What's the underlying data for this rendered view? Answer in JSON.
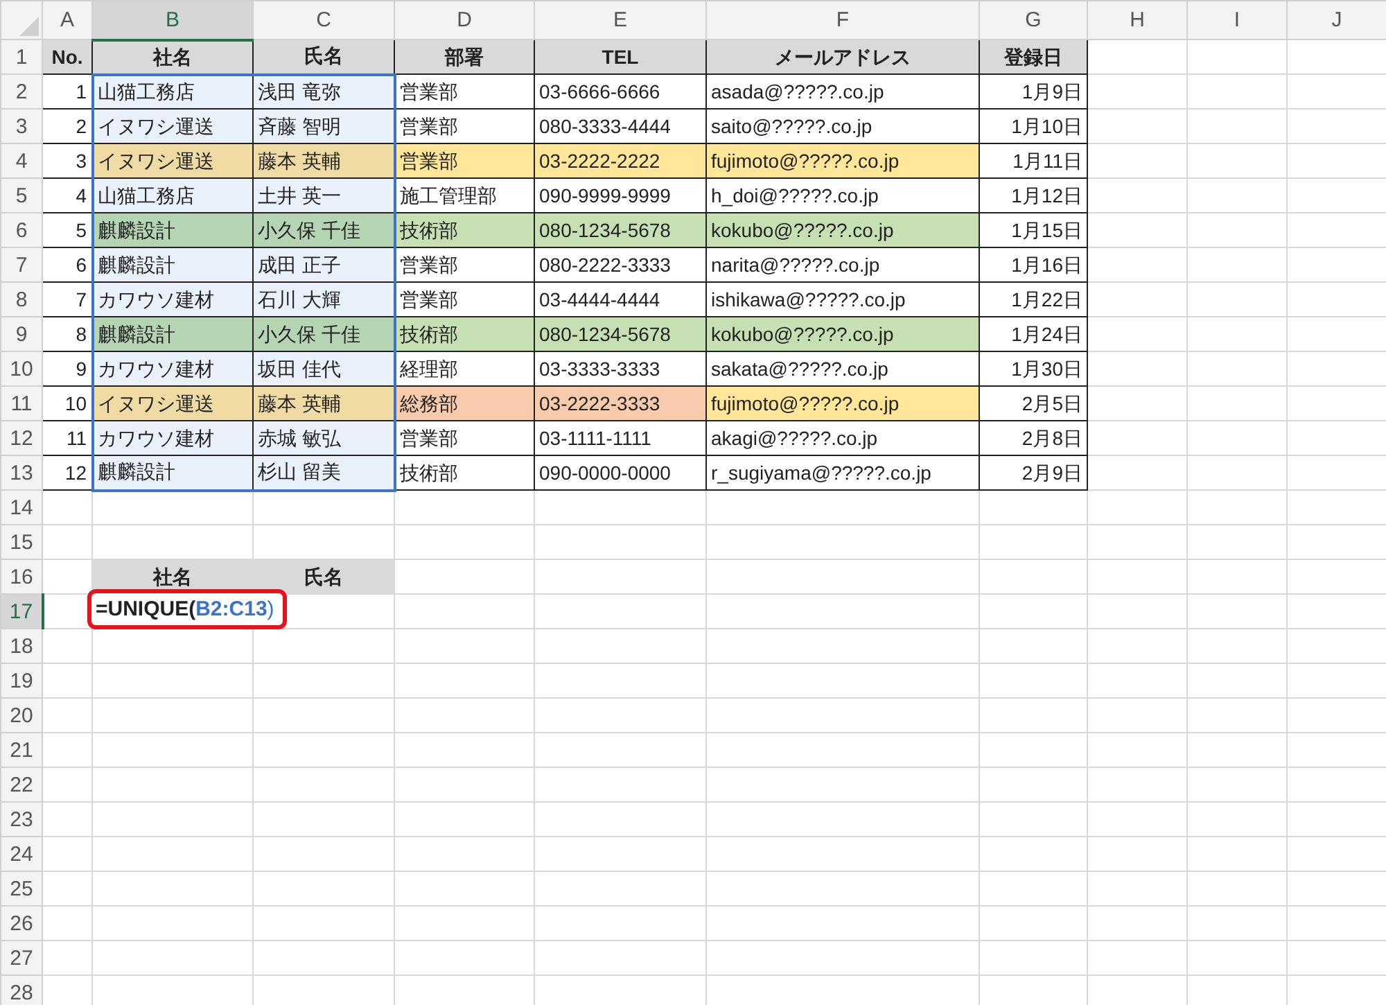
{
  "column_headers": [
    {
      "label": "A",
      "selected": false
    },
    {
      "label": "B",
      "selected": true
    },
    {
      "label": "C",
      "selected": false
    },
    {
      "label": "D",
      "selected": false
    },
    {
      "label": "E",
      "selected": false
    },
    {
      "label": "F",
      "selected": false
    },
    {
      "label": "G",
      "selected": false
    },
    {
      "label": "H",
      "selected": false
    },
    {
      "label": "I",
      "selected": false
    },
    {
      "label": "J",
      "selected": false
    }
  ],
  "row_headers": [
    {
      "label": "1",
      "selected": false
    },
    {
      "label": "2",
      "selected": false
    },
    {
      "label": "3",
      "selected": false
    },
    {
      "label": "4",
      "selected": false
    },
    {
      "label": "5",
      "selected": false
    },
    {
      "label": "6",
      "selected": false
    },
    {
      "label": "7",
      "selected": false
    },
    {
      "label": "8",
      "selected": false
    },
    {
      "label": "9",
      "selected": false
    },
    {
      "label": "10",
      "selected": false
    },
    {
      "label": "11",
      "selected": false
    },
    {
      "label": "12",
      "selected": false
    },
    {
      "label": "13",
      "selected": false
    },
    {
      "label": "14",
      "selected": false
    },
    {
      "label": "15",
      "selected": false
    },
    {
      "label": "16",
      "selected": false
    },
    {
      "label": "17",
      "selected": true
    },
    {
      "label": "18",
      "selected": false
    },
    {
      "label": "19",
      "selected": false
    },
    {
      "label": "20",
      "selected": false
    },
    {
      "label": "21",
      "selected": false
    },
    {
      "label": "22",
      "selected": false
    },
    {
      "label": "23",
      "selected": false
    },
    {
      "label": "24",
      "selected": false
    },
    {
      "label": "25",
      "selected": false
    },
    {
      "label": "26",
      "selected": false
    },
    {
      "label": "27",
      "selected": false
    },
    {
      "label": "28",
      "selected": false
    }
  ],
  "table": {
    "columns": [
      {
        "label": "No.",
        "kind": "number",
        "referenced": false
      },
      {
        "label": "社名",
        "kind": "text",
        "referenced": true
      },
      {
        "label": "氏名",
        "kind": "text",
        "referenced": true
      },
      {
        "label": "部署",
        "kind": "text",
        "referenced": false
      },
      {
        "label": "TEL",
        "kind": "text",
        "referenced": false
      },
      {
        "label": "メールアドレス",
        "kind": "text",
        "referenced": false
      },
      {
        "label": "登録日",
        "kind": "date",
        "referenced": false
      }
    ],
    "rows": [
      {
        "cells": [
          {
            "text": "1"
          },
          {
            "text": "山猫工務店"
          },
          {
            "text": "浅田 竜弥"
          },
          {
            "text": "営業部"
          },
          {
            "text": "03-6666-6666"
          },
          {
            "text": "asada@?????.co.jp"
          },
          {
            "text": "1月9日"
          }
        ]
      },
      {
        "cells": [
          {
            "text": "2"
          },
          {
            "text": "イヌワシ運送"
          },
          {
            "text": "斉藤 智明"
          },
          {
            "text": "営業部"
          },
          {
            "text": "080-3333-4444"
          },
          {
            "text": "saito@?????.co.jp"
          },
          {
            "text": "1月10日"
          }
        ]
      },
      {
        "cells": [
          {
            "text": "3"
          },
          {
            "text": "イヌワシ運送",
            "color": "#efdba3"
          },
          {
            "text": "藤本 英輔",
            "color": "#efdba3"
          },
          {
            "text": "営業部",
            "color": "#ffe699"
          },
          {
            "text": "03-2222-2222",
            "color": "#ffe699"
          },
          {
            "text": "fujimoto@?????.co.jp",
            "color": "#ffe699"
          },
          {
            "text": "1月11日"
          }
        ]
      },
      {
        "cells": [
          {
            "text": "4"
          },
          {
            "text": "山猫工務店"
          },
          {
            "text": "土井 英一"
          },
          {
            "text": "施工管理部"
          },
          {
            "text": "090-9999-9999"
          },
          {
            "text": "h_doi@?????.co.jp"
          },
          {
            "text": "1月12日"
          }
        ]
      },
      {
        "cells": [
          {
            "text": "5"
          },
          {
            "text": "麒麟設計",
            "color": "#b5d4b3"
          },
          {
            "text": "小久保 千佳",
            "color": "#b5d4b3"
          },
          {
            "text": "技術部",
            "color": "#c6e0b4"
          },
          {
            "text": "080-1234-5678",
            "color": "#c6e0b4"
          },
          {
            "text": "kokubo@?????.co.jp",
            "color": "#c6e0b4"
          },
          {
            "text": "1月15日"
          }
        ]
      },
      {
        "cells": [
          {
            "text": "6"
          },
          {
            "text": "麒麟設計"
          },
          {
            "text": "成田 正子"
          },
          {
            "text": "営業部"
          },
          {
            "text": "080-2222-3333"
          },
          {
            "text": "narita@?????.co.jp"
          },
          {
            "text": "1月16日"
          }
        ]
      },
      {
        "cells": [
          {
            "text": "7"
          },
          {
            "text": "カワウソ建材"
          },
          {
            "text": "石川 大輝"
          },
          {
            "text": "営業部"
          },
          {
            "text": "03-4444-4444"
          },
          {
            "text": "ishikawa@?????.co.jp"
          },
          {
            "text": "1月22日"
          }
        ]
      },
      {
        "cells": [
          {
            "text": "8"
          },
          {
            "text": "麒麟設計",
            "color": "#b5d4b3"
          },
          {
            "text": "小久保 千佳",
            "color": "#b5d4b3"
          },
          {
            "text": "技術部",
            "color": "#c6e0b4"
          },
          {
            "text": "080-1234-5678",
            "color": "#c6e0b4"
          },
          {
            "text": "kokubo@?????.co.jp",
            "color": "#c6e0b4"
          },
          {
            "text": "1月24日"
          }
        ]
      },
      {
        "cells": [
          {
            "text": "9"
          },
          {
            "text": "カワウソ建材"
          },
          {
            "text": "坂田 佳代"
          },
          {
            "text": "経理部"
          },
          {
            "text": "03-3333-3333"
          },
          {
            "text": "sakata@?????.co.jp"
          },
          {
            "text": "1月30日"
          }
        ]
      },
      {
        "cells": [
          {
            "text": "10"
          },
          {
            "text": "イヌワシ運送",
            "color": "#efdba3"
          },
          {
            "text": "藤本 英輔",
            "color": "#efdba3"
          },
          {
            "text": "総務部",
            "color": "#f8cbad"
          },
          {
            "text": "03-2222-3333",
            "color": "#f8cbad"
          },
          {
            "text": "fujimoto@?????.co.jp",
            "color": "#ffe699"
          },
          {
            "text": "2月5日"
          }
        ]
      },
      {
        "cells": [
          {
            "text": "11"
          },
          {
            "text": "カワウソ建材"
          },
          {
            "text": "赤城 敏弘"
          },
          {
            "text": "営業部"
          },
          {
            "text": "03-1111-1111"
          },
          {
            "text": "akagi@?????.co.jp"
          },
          {
            "text": "2月8日"
          }
        ]
      },
      {
        "cells": [
          {
            "text": "12"
          },
          {
            "text": "麒麟設計"
          },
          {
            "text": "杉山 留美"
          },
          {
            "text": "技術部"
          },
          {
            "text": "090-0000-0000"
          },
          {
            "text": "r_sugiyama@?????.co.jp"
          },
          {
            "text": "2月9日"
          }
        ]
      }
    ]
  },
  "unique_output": {
    "headers": [
      "社名",
      "氏名"
    ],
    "formula_highlighted": true,
    "formula_parts": [
      {
        "text": "=UNIQUE(",
        "kind": "function"
      },
      {
        "text": "B2:C13",
        "kind": "reference"
      },
      {
        "text": ")",
        "kind": "paren"
      }
    ]
  }
}
